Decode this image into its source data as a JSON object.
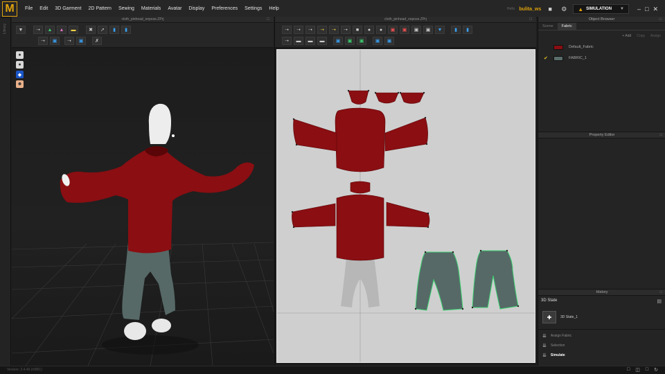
{
  "app": {
    "logo_letter": "M"
  },
  "menu": [
    "File",
    "Edit",
    "3D Garment",
    "2D Pattern",
    "Sewing",
    "Materials",
    "Avatar",
    "Display",
    "Preferences",
    "Settings",
    "Help"
  ],
  "user": {
    "label": "Hello",
    "name": "bulita_ws"
  },
  "simulation_label": "SIMULATION",
  "left_strip_label": "Library",
  "view3d": {
    "title": "cloth_pinhead_onpose.ZPrj"
  },
  "view2d": {
    "title": "cloth_pinhead_onpose.ZPrj"
  },
  "object_browser": {
    "title": "Object Browser",
    "tabs": [
      "Scene",
      "Fabric"
    ],
    "active_tab": "Fabric",
    "actions": {
      "add": "+ Add",
      "copy": "Copy",
      "assign": "Assign"
    },
    "fabrics": [
      {
        "name": "Default_Fabric",
        "color": "#8a0e12",
        "checked": false
      },
      {
        "name": "FABRIC_1",
        "color": "#5a6d6b",
        "checked": true
      }
    ]
  },
  "property_editor": {
    "title": "Property Editor"
  },
  "history": {
    "title": "History",
    "section": "3D State",
    "state_item": "3D State_1",
    "rows": [
      "Assign Fabric",
      "Selection",
      "Simulate"
    ]
  },
  "status": {
    "text": "Version: 2.4.46    (r6861)"
  },
  "colors": {
    "accent": "#e0a30b",
    "garment_red": "#8a0e12",
    "garment_green": "#5a6d6b",
    "seam_green": "#3cd070"
  }
}
